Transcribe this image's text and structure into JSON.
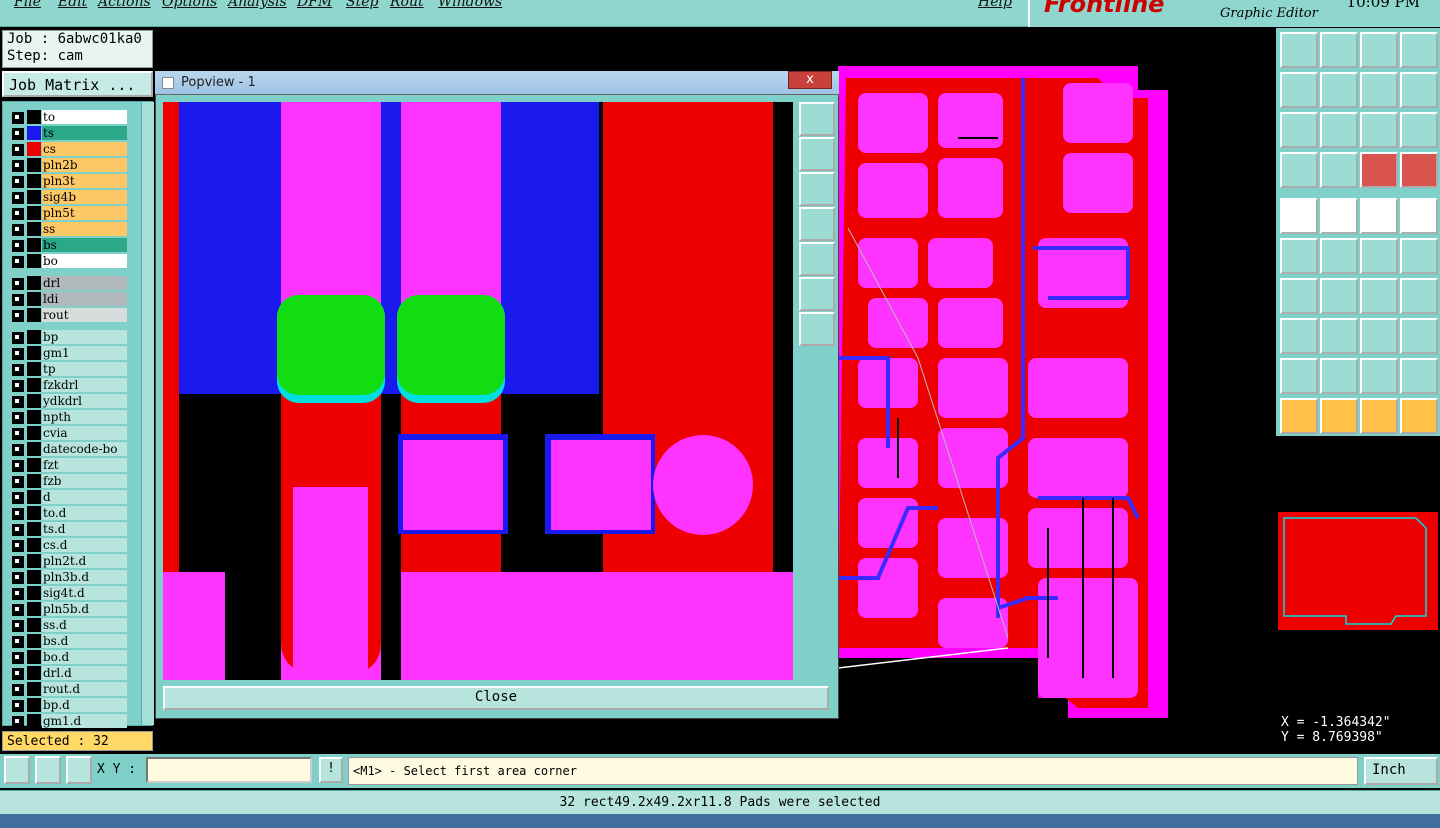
{
  "menu": [
    "File",
    "Edit",
    "Actions",
    "Options",
    "Analysis",
    "DFM",
    "Step",
    "Rout",
    "Windows",
    "Help"
  ],
  "clock": "10:09 PM",
  "brand": "Frontline",
  "brand_sub": "Graphic Editor",
  "job": {
    "job_line": "Job : 6abwc01ka0",
    "step_line": "Step: cam"
  },
  "job_matrix_label": "Job Matrix ...",
  "layers": [
    {
      "name": "to",
      "color": "#ffffff"
    },
    {
      "name": "ts",
      "color": "#2aa888"
    },
    {
      "name": "cs",
      "color": "#ffc866"
    },
    {
      "name": "pln2b",
      "color": "#ffc866"
    },
    {
      "name": "pln3t",
      "color": "#ffc866"
    },
    {
      "name": "sig4b",
      "color": "#ffc866"
    },
    {
      "name": "pln5t",
      "color": "#ffc866"
    },
    {
      "name": "ss",
      "color": "#ffc866"
    },
    {
      "name": "bs",
      "color": "#2aa888"
    },
    {
      "name": "bo",
      "color": "#ffffff"
    },
    {
      "name": "drl",
      "color": "#b0b8bc"
    },
    {
      "name": "ldi",
      "color": "#b0b8bc"
    },
    {
      "name": "rout",
      "color": "#d8dcdc"
    },
    {
      "name": "bp",
      "color": "#b8e4de"
    },
    {
      "name": "gm1",
      "color": "#b8e4de"
    },
    {
      "name": "tp",
      "color": "#b8e4de"
    },
    {
      "name": "fzkdrl",
      "color": "#b8e4de"
    },
    {
      "name": "ydkdrl",
      "color": "#b8e4de"
    },
    {
      "name": "npth",
      "color": "#b8e4de"
    },
    {
      "name": "cvia",
      "color": "#b8e4de"
    },
    {
      "name": "datecode-bo",
      "color": "#b8e4de"
    },
    {
      "name": "fzt",
      "color": "#b8e4de"
    },
    {
      "name": "fzb",
      "color": "#b8e4de"
    },
    {
      "name": "d",
      "color": "#b8e4de"
    },
    {
      "name": "to.d",
      "color": "#b8e4de"
    },
    {
      "name": "ts.d",
      "color": "#b8e4de"
    },
    {
      "name": "cs.d",
      "color": "#b8e4de"
    },
    {
      "name": "pln2t.d",
      "color": "#b8e4de"
    },
    {
      "name": "pln3b.d",
      "color": "#b8e4de"
    },
    {
      "name": "sig4t.d",
      "color": "#b8e4de"
    },
    {
      "name": "pln5b.d",
      "color": "#b8e4de"
    },
    {
      "name": "ss.d",
      "color": "#b8e4de"
    },
    {
      "name": "bs.d",
      "color": "#b8e4de"
    },
    {
      "name": "bo.d",
      "color": "#b8e4de"
    },
    {
      "name": "drl.d",
      "color": "#b8e4de"
    },
    {
      "name": "rout.d",
      "color": "#b8e4de"
    },
    {
      "name": "bp.d",
      "color": "#b8e4de"
    },
    {
      "name": "gm1.d",
      "color": "#b8e4de"
    }
  ],
  "selected_label": "Selected : 32",
  "popup": {
    "title": "Popview - 1",
    "close_label": "Close",
    "close_x": "x"
  },
  "coords": {
    "x": "X = -1.364342\"",
    "y": "Y = 8.769398\""
  },
  "cmd": {
    "xy_label": "X Y :",
    "xy_value": "",
    "prompt": "<M1> - Select first area corner",
    "units": "Inch",
    "bang": "!"
  },
  "status_text": "32 rect49.2x49.2xr11.8 Pads were selected"
}
